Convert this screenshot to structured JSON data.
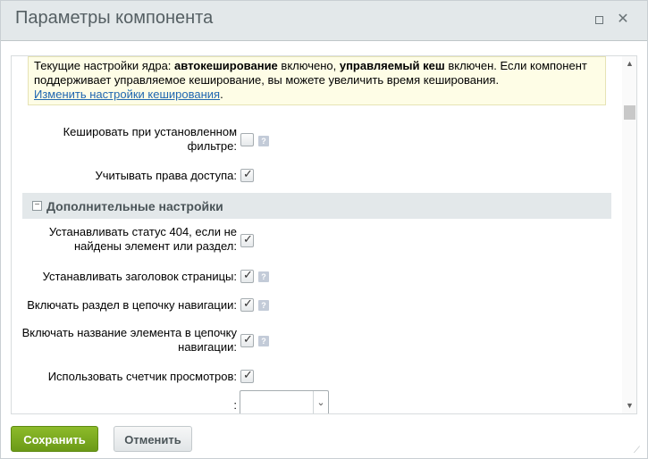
{
  "window": {
    "title": "Параметры компонента",
    "maximize_icon": "maximize-icon",
    "close_icon": "close-icon",
    "close_glyph": "✕"
  },
  "notice": {
    "text_prefix": "Текущие настройки ядра: ",
    "bold1": "автокеширование",
    "text_mid": " включено, ",
    "bold2": "управляемый кеш",
    "text_suffix": " включен. Если компонент поддерживает управляемое кеширование, вы можете увеличить время кеширования.",
    "link": "Изменить настройки кеширования",
    "link_end": "."
  },
  "fields": {
    "cache_filter": {
      "label": "Кешировать при установленном фильтре:",
      "checked": false
    },
    "access_rights": {
      "label": "Учитывать права доступа:",
      "checked": true
    },
    "status_404": {
      "label": "Устанавливать статус 404, если не найдены элемент или раздел:",
      "checked": true
    },
    "page_title": {
      "label": "Устанавливать заголовок страницы:",
      "checked": true
    },
    "section_chain": {
      "label": "Включать раздел в цепочку навигации:",
      "checked": true
    },
    "element_chain": {
      "label": "Включать название элемента в цепочку навигации:",
      "checked": true
    },
    "view_counter": {
      "label": "Использовать счетчик просмотров:",
      "checked": true
    },
    "select_field": {
      "label": ":",
      "value": ""
    }
  },
  "section": {
    "title": "Дополнительные настройки",
    "toggle_glyph": "−"
  },
  "help_glyph": "?",
  "check_glyph": "✓",
  "buttons": {
    "save": "Сохранить",
    "cancel": "Отменить"
  },
  "colors": {
    "save_bg": "#7aaa1f",
    "titlebar_bg": "#e3e8ea",
    "notice_bg": "#fefde6",
    "link": "#2067b0"
  }
}
